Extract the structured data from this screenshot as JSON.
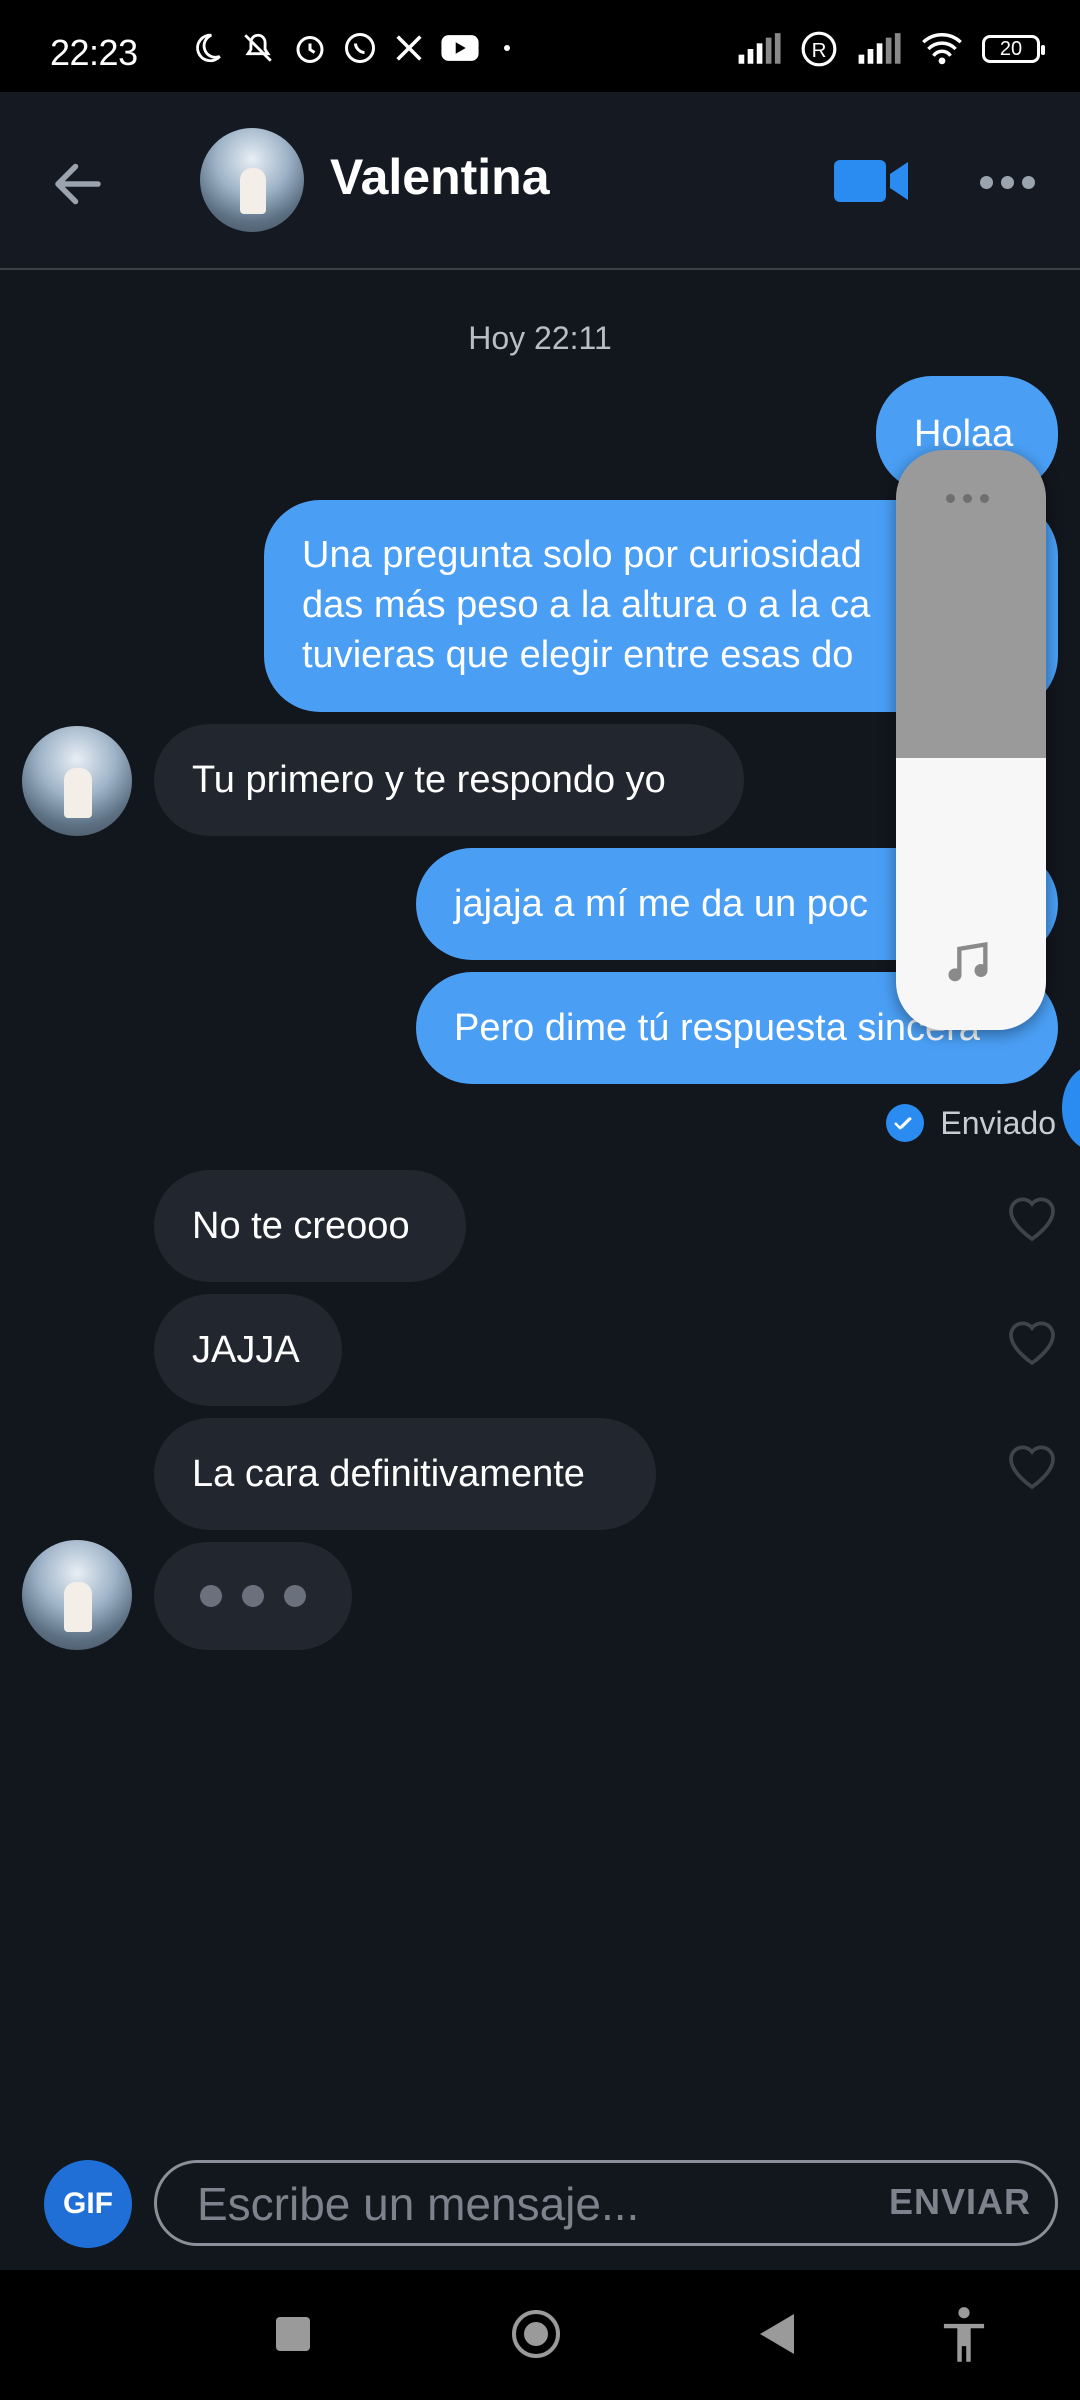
{
  "status_bar": {
    "time": "22:23",
    "battery": "20"
  },
  "header": {
    "back_label": "Atrás",
    "contact_name": "Valentina"
  },
  "conversation": {
    "date_separator": "Hoy 22:11",
    "messages": [
      {
        "direction": "out",
        "text": "Holaa"
      },
      {
        "direction": "out",
        "lines": [
          "Una pregunta solo por curiosidad",
          "das más peso a la altura o a la ca",
          "tuvieras que elegir entre esas do"
        ]
      },
      {
        "direction": "in",
        "text": "Tu primero y te respondo yo"
      },
      {
        "direction": "out",
        "text": "jajaja a mí me da un poc"
      },
      {
        "direction": "out",
        "text": "Pero dime tú respuesta sincera"
      },
      {
        "direction": "in",
        "text": "No te creooo"
      },
      {
        "direction": "in",
        "text": "JAJJA"
      },
      {
        "direction": "in",
        "text": "La cara definitivamente"
      }
    ],
    "sent_status": "Enviado"
  },
  "composer": {
    "gif_label": "GIF",
    "placeholder": "Escribe un mensaje...",
    "send_label": "ENVIAR"
  },
  "colors": {
    "outgoing": "#4a9ff5",
    "incoming": "#22262f",
    "background": "#12161d",
    "accent": "#2a8cf0"
  },
  "icons": [
    "back-arrow-icon",
    "video-camera-icon",
    "more-options-icon",
    "heart-icon",
    "music-note-icon",
    "accessibility-icon"
  ]
}
